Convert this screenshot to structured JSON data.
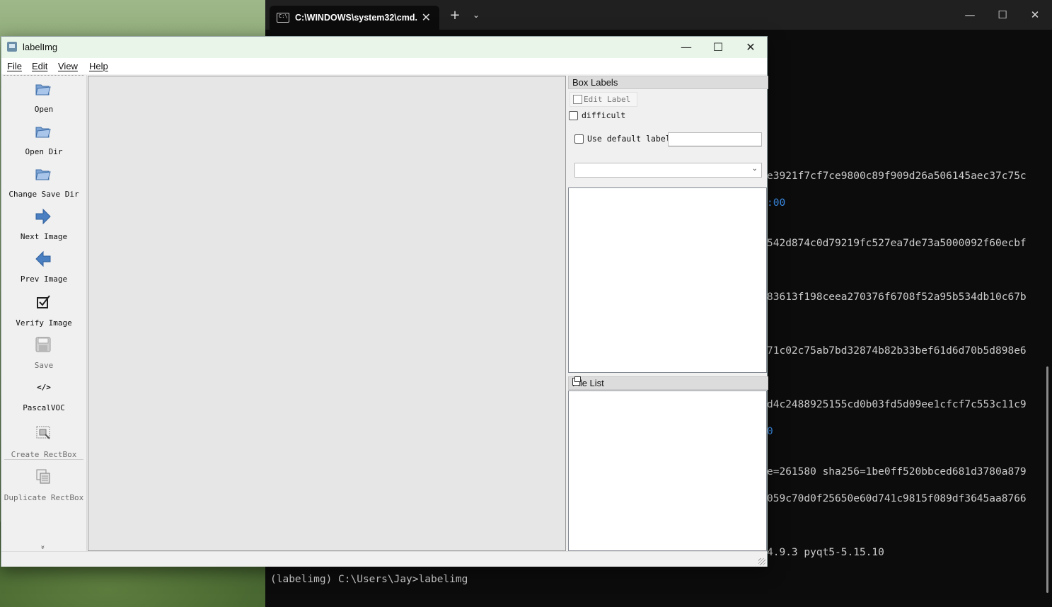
{
  "terminal": {
    "tab_title": "C:\\WINDOWS\\system32\\cmd.",
    "tab_close": "✕",
    "new_tab": "+",
    "dropdown": "⌄",
    "minimize": "—",
    "maximize": "☐",
    "close": "✕",
    "lines": [
      {
        "text": "e3921f7cf7ce9800c89f909d26a506145aec37c75c",
        "color": "default"
      },
      {
        "text": ":00",
        "color": "blue"
      },
      {
        "text": "542d874c0d79219fc527ea7de73a5000092f60ecbf",
        "color": "default"
      },
      {
        "text": "83613f198ceea270376f6708f52a95b534db10c67b",
        "color": "default"
      },
      {
        "text": "71c02c75ab7bd32874b82b33bef61d6d70b5d898e6",
        "color": "default"
      },
      {
        "text": "d4c2488925155cd0b03fd5d09ee1cfcf7c553c11c9",
        "color": "default"
      },
      {
        "text": "0",
        "color": "blue"
      },
      {
        "text": "e=261580 sha256=1be0ff520bbced681d3780a879",
        "color": "default"
      },
      {
        "text": "059c70d0f25650e60d741c9815f089df3645aa8766",
        "color": "default"
      },
      {
        "text": "4.9.3 pyqt5-5.15.10",
        "color": "default"
      }
    ],
    "prompt": "(labelimg) C:\\Users\\Jay>labelimg"
  },
  "labelimg": {
    "title": "labelImg",
    "window_minimize": "—",
    "window_maximize": "☐",
    "window_close": "✕",
    "menu": {
      "file": "File",
      "edit": "Edit",
      "view": "View",
      "help": "Help"
    },
    "toolbar": {
      "open": "Open",
      "open_dir": "Open Dir",
      "change_save_dir": "Change Save Dir",
      "next_image": "Next Image",
      "prev_image": "Prev Image",
      "verify_image": "Verify Image",
      "save": "Save",
      "format": "PascalVOC",
      "format_icon_text": "</>",
      "create_rectbox": "Create RectBox",
      "duplicate_rectbox": "Duplicate RectBox",
      "extension": "»"
    },
    "box_labels": {
      "title": "Box Labels",
      "edit_label": "Edit Label",
      "difficult": "difficult",
      "use_default_label": "Use default label",
      "default_label_value": "",
      "selected_label": ""
    },
    "file_list": {
      "title": "File List"
    }
  },
  "colors": {
    "terminal_bg": "#0c0c0c",
    "terminal_text": "#cccccc",
    "terminal_blue": "#3b8eea",
    "window_bg": "#f0f0f0",
    "titlebar_bg": "#e8f5e8",
    "icon_blue": "#4a7fc1"
  }
}
